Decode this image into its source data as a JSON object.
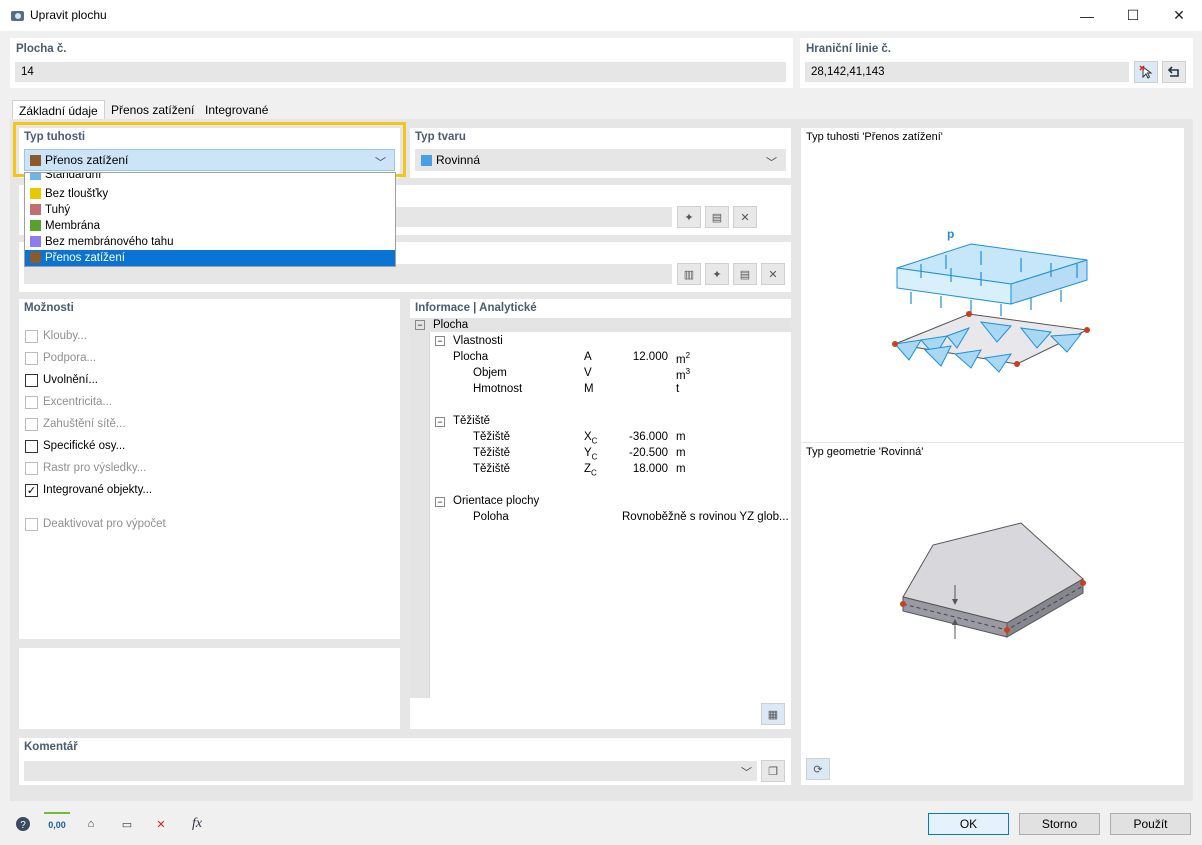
{
  "window": {
    "title": "Upravit plochu",
    "minimize": "—",
    "maximize": "☐",
    "close": "✕"
  },
  "surface_no": {
    "label": "Plocha č.",
    "value": "14"
  },
  "boundary_lines": {
    "label": "Hraniční linie č.",
    "value": "28,142,41,143"
  },
  "tabs": [
    {
      "label": "Základní údaje"
    },
    {
      "label": "Přenos zatížení"
    },
    {
      "label": "Integrované"
    }
  ],
  "stiffness": {
    "label": "Typ tuhosti",
    "selected": "Přenos zatížení",
    "selected_color": "#8b5a2b",
    "options": [
      {
        "label": "Standardní",
        "color": "#6fb4e8"
      },
      {
        "label": "Bez tloušťky",
        "color": "#e8c800"
      },
      {
        "label": "Tuhý",
        "color": "#c07070"
      },
      {
        "label": "Membrána",
        "color": "#5aa02c"
      },
      {
        "label": "Bez membránového tahu",
        "color": "#8f7cf0"
      },
      {
        "label": "Přenos zatížení",
        "color": "#8b5a2b"
      }
    ]
  },
  "shape": {
    "label": "Typ tvaru",
    "selected": "Rovinná",
    "selected_color": "#4a9ee8"
  },
  "options": {
    "title": "Možnosti",
    "items": [
      {
        "label": "Klouby...",
        "enabled": false,
        "checked": false
      },
      {
        "label": "Podpora...",
        "enabled": false,
        "checked": false
      },
      {
        "label": "Uvolnění...",
        "enabled": true,
        "checked": false
      },
      {
        "label": "Excentricita...",
        "enabled": false,
        "checked": false
      },
      {
        "label": "Zahuštění sítě...",
        "enabled": false,
        "checked": false
      },
      {
        "label": "Specifické osy...",
        "enabled": true,
        "checked": false
      },
      {
        "label": "Rastr pro výsledky...",
        "enabled": false,
        "checked": false
      },
      {
        "label": "Integrované objekty...",
        "enabled": true,
        "checked": true
      },
      {
        "label": "Deaktivovat pro výpočet",
        "enabled": false,
        "checked": false
      }
    ]
  },
  "info": {
    "title": "Informace | Analytické",
    "root": "Plocha",
    "properties": {
      "label": "Vlastnosti",
      "rows": [
        {
          "name": "Plocha",
          "sym": "A",
          "val": "12.000",
          "unit": "m",
          "sup": "2"
        },
        {
          "name": "Objem",
          "sym": "V",
          "val": "",
          "unit": "m",
          "sup": "3"
        },
        {
          "name": "Hmotnost",
          "sym": "M",
          "val": "",
          "unit": "t",
          "sup": ""
        }
      ]
    },
    "centroid": {
      "label": "Těžiště",
      "rows": [
        {
          "name": "Těžiště",
          "sym": "X",
          "sub": "C",
          "val": "-36.000",
          "unit": "m"
        },
        {
          "name": "Těžiště",
          "sym": "Y",
          "sub": "C",
          "val": "-20.500",
          "unit": "m"
        },
        {
          "name": "Těžiště",
          "sym": "Z",
          "sub": "C",
          "val": "18.000",
          "unit": "m"
        }
      ]
    },
    "orientation": {
      "label": "Orientace plochy",
      "row": {
        "name": "Poloha",
        "val": "Rovnoběžně s rovinou YZ glob..."
      }
    }
  },
  "preview": {
    "stiffness_caption": "Typ tuhosti 'Přenos zatížení'",
    "geometry_caption": "Typ geometrie 'Rovinná'",
    "load_symbol": "p"
  },
  "comment": {
    "label": "Komentář",
    "value": ""
  },
  "buttons": {
    "ok": "OK",
    "cancel": "Storno",
    "apply": "Použít"
  },
  "bottom_icons": {
    "units": "0,00"
  },
  "colors": {
    "accent": "#0078d7",
    "highlight": "#f5c518",
    "load_blue": "#1e90d8"
  }
}
